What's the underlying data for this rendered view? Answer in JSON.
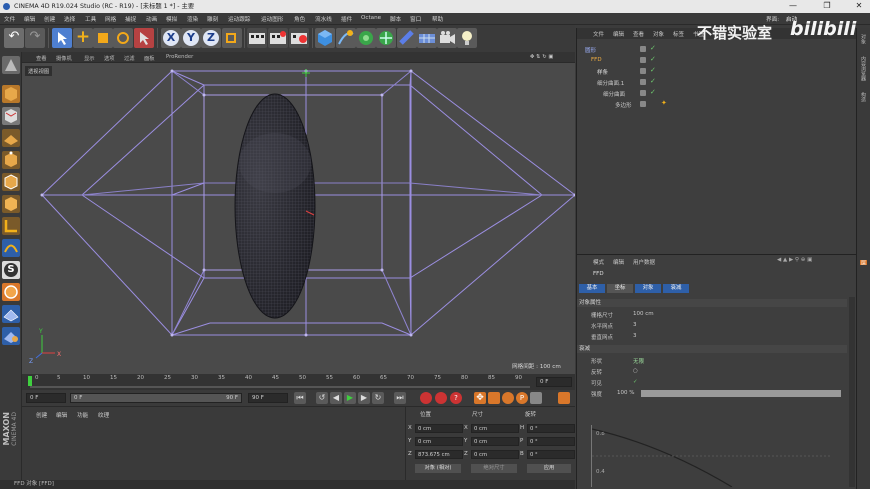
{
  "titlebar": {
    "title": "CINEMA 4D R19.024 Studio (RC - R19) - [未标题 1 *] - 主要",
    "min": "—",
    "max": "❐",
    "close": "✕"
  },
  "menu": [
    "文件",
    "编辑",
    "创建",
    "选择",
    "工具",
    "网格",
    "捕捉",
    "动画",
    "模拟",
    "渲染",
    "雕刻",
    "运动跟踪",
    "运动图形",
    "角色",
    "流水线",
    "插件",
    "Octane",
    "脚本",
    "窗口",
    "帮助"
  ],
  "layout_label": "界面:",
  "layout_value": "启动",
  "toolbar_axes": [
    "X",
    "Y",
    "Z"
  ],
  "viewport": {
    "menu": [
      "查看",
      "摄像机",
      "显示",
      "选项",
      "过滤",
      "面板",
      "ProRender"
    ],
    "label": "透视视图",
    "grid_spacing": "网格间距 : 100 cm",
    "axis_y": "Y",
    "axis_z": "Z",
    "axis_x": "X"
  },
  "timeline": {
    "ticks": [
      "0",
      "5",
      "10",
      "15",
      "20",
      "25",
      "30",
      "35",
      "40",
      "45",
      "50",
      "55",
      "60",
      "65",
      "70",
      "75",
      "80",
      "85",
      "90"
    ],
    "end_field": "0 F"
  },
  "transport": {
    "start": "0 F",
    "range_start": "0 F",
    "range_end": "90 F",
    "end": "90 F"
  },
  "materials": {
    "menu": [
      "创建",
      "编辑",
      "功能",
      "纹理"
    ]
  },
  "maxon": {
    "brand": "MAXON",
    "product": "CINEMA 4D"
  },
  "coords": {
    "headers": {
      "pos": "位置",
      "size": "尺寸",
      "rot": "旋转"
    },
    "rows": [
      {
        "axis": "X",
        "pos": "0 cm",
        "size_axis": "X",
        "size": "0 cm",
        "rot_axis": "H",
        "rot": "0 °"
      },
      {
        "axis": "Y",
        "pos": "0 cm",
        "size_axis": "Y",
        "size": "0 cm",
        "rot_axis": "P",
        "rot": "0 °"
      },
      {
        "axis": "Z",
        "pos": "873.675 cm",
        "size_axis": "Z",
        "size": "0 cm",
        "rot_axis": "B",
        "rot": "0 °"
      }
    ],
    "mode1": "对象 (相对)",
    "mode2": "绝对尺寸",
    "apply": "应用"
  },
  "status": "FFD 对象 [FFD]",
  "objects": {
    "menu": [
      "文件",
      "编辑",
      "查看",
      "对象",
      "标签",
      "书签"
    ],
    "rows": [
      {
        "name": "圆形",
        "color": "#9fb3ff",
        "indent": 0,
        "selected": false
      },
      {
        "name": "FFD",
        "color": "#f5b142",
        "indent": 8,
        "selected": true
      },
      {
        "name": "样条",
        "color": "#e0e0e0",
        "indent": 14,
        "selected": false
      },
      {
        "name": "细分曲面.1",
        "color": "#c8c8c8",
        "indent": 14,
        "selected": false
      },
      {
        "name": "细分曲面",
        "color": "#c8c8c8",
        "indent": 20,
        "selected": false
      },
      {
        "name": "多边形",
        "color": "#c8c8c8",
        "indent": 28,
        "selected": false
      }
    ]
  },
  "attributes": {
    "menu": [
      "模式",
      "编辑",
      "用户数据"
    ],
    "title": "FFD",
    "tabs": [
      "基本",
      "坐标",
      "对象",
      "衰减"
    ],
    "hdr_object": "对象属性",
    "obj_fields": [
      {
        "label": "栅格尺寸",
        "value": "100 cm"
      },
      {
        "label": "水平网点",
        "value": "3"
      },
      {
        "label": "垂直网点",
        "value": "3"
      }
    ],
    "hdr_falloff": "衰减",
    "falloff": [
      {
        "label": "形状",
        "value": "无限"
      },
      {
        "label": "反转",
        "value": ""
      },
      {
        "label": "可见",
        "value": ""
      },
      {
        "label": "强度",
        "value": "100 %"
      }
    ],
    "graph_ticks": [
      "0.8",
      "0.4"
    ]
  },
  "watermark": "不错实验室",
  "bilibili": "bilibili",
  "rightstrip": [
    "对象",
    "内容浏览器",
    "构造",
    "层"
  ]
}
